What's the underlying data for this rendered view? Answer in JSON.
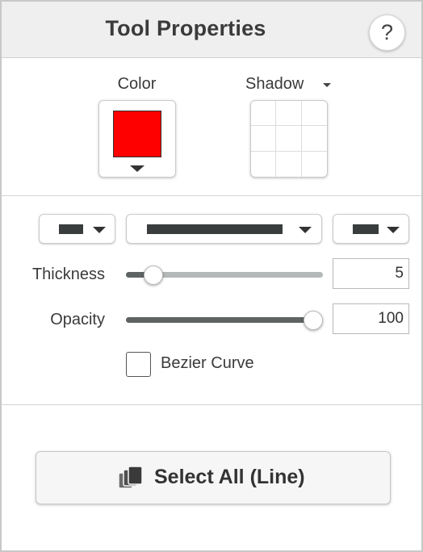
{
  "header": {
    "title": "Tool Properties",
    "help_label": "?"
  },
  "color": {
    "label": "Color",
    "value": "#ff0000"
  },
  "shadow": {
    "label": "Shadow"
  },
  "line_style": {
    "start_cap_icon": "line-start-style-icon",
    "line_style_icon": "line-dash-style-icon",
    "end_cap_icon": "line-end-style-icon"
  },
  "thickness": {
    "label": "Thickness",
    "value": "5",
    "level_fraction": 0.1
  },
  "opacity": {
    "label": "Opacity",
    "value": "100",
    "level_fraction": 1.0
  },
  "bezier": {
    "label": "Bezier Curve",
    "checked": false
  },
  "select_all": {
    "label": "Select All (Line)",
    "icon": "stacked-shapes-icon"
  }
}
